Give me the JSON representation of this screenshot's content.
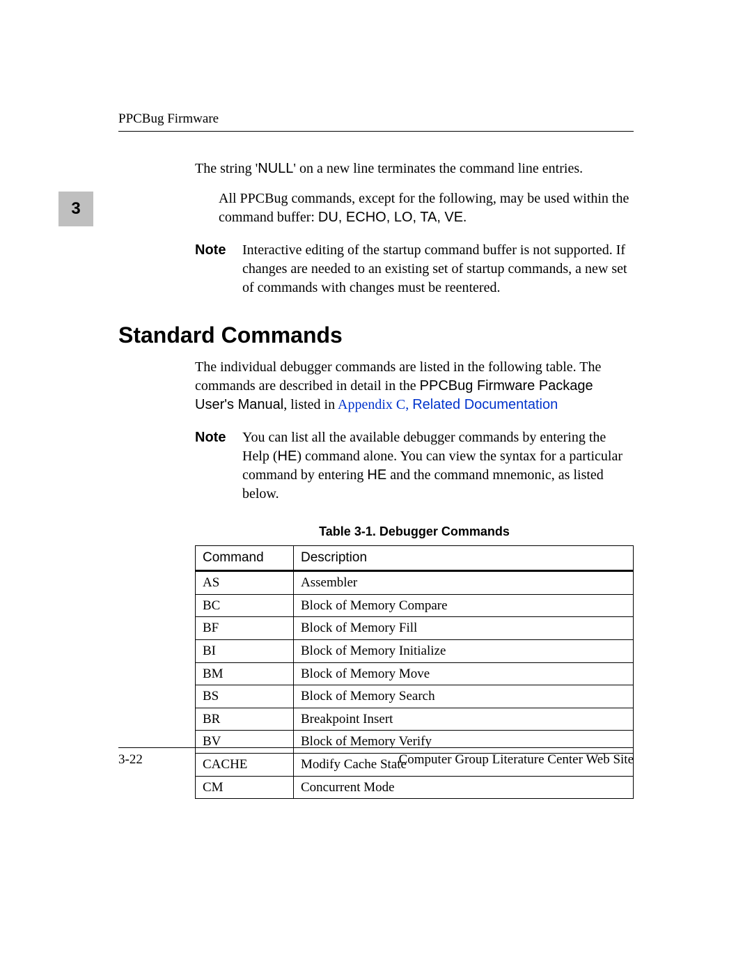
{
  "header": {
    "running_head": "PPCBug Firmware"
  },
  "chapter_tab": "3",
  "para1_pre": "The string '",
  "para1_null": "NULL",
  "para1_post": "' on a new line terminates the command line entries.",
  "para2_pre": "All PPCBug commands, except for the following, may be used within the command buffer: ",
  "para2_cmds": "DU, ECHO, LO, TA, VE",
  "para2_post": ".",
  "note1": {
    "label": "Note",
    "text": "Interactive editing of the startup command buffer is not supported. If changes are needed to an existing set of startup commands, a new set of commands with changes must be reentered."
  },
  "section_title": "Standard Commands",
  "para3_a": "The individual debugger commands are listed in the following table. The commands are described in detail in the ",
  "para3_b": "PPCBug Firmware Package User's Manual",
  "para3_c": ", listed in ",
  "para3_link_a": "Appendix C, ",
  "para3_link_b": "Related Documentation",
  "note2": {
    "label": "Note",
    "pre": "You can list all the available debugger commands by entering the Help (",
    "he1": "HE",
    "mid": ") command alone. You can view the syntax for a particular command by entering ",
    "he2": "HE",
    "post": " and the command mnemonic, as listed below."
  },
  "table": {
    "title": "Table 3-1.  Debugger Commands",
    "col1": "Command",
    "col2": "Description",
    "rows": [
      {
        "cmd": "AS",
        "desc": "Assembler"
      },
      {
        "cmd": "BC",
        "desc": "Block of Memory Compare"
      },
      {
        "cmd": "BF",
        "desc": "Block of Memory Fill"
      },
      {
        "cmd": "BI",
        "desc": "Block of Memory Initialize"
      },
      {
        "cmd": "BM",
        "desc": "Block of Memory Move"
      },
      {
        "cmd": "BS",
        "desc": "Block of Memory Search"
      },
      {
        "cmd": "BR",
        "desc": "Breakpoint Insert"
      },
      {
        "cmd": "BV",
        "desc": "Block of Memory Verify"
      },
      {
        "cmd": "CACHE",
        "desc": "Modify Cache State"
      },
      {
        "cmd": "CM",
        "desc": "Concurrent Mode"
      }
    ]
  },
  "footer": {
    "left": "3-22",
    "right": "Computer Group Literature Center Web Site"
  }
}
